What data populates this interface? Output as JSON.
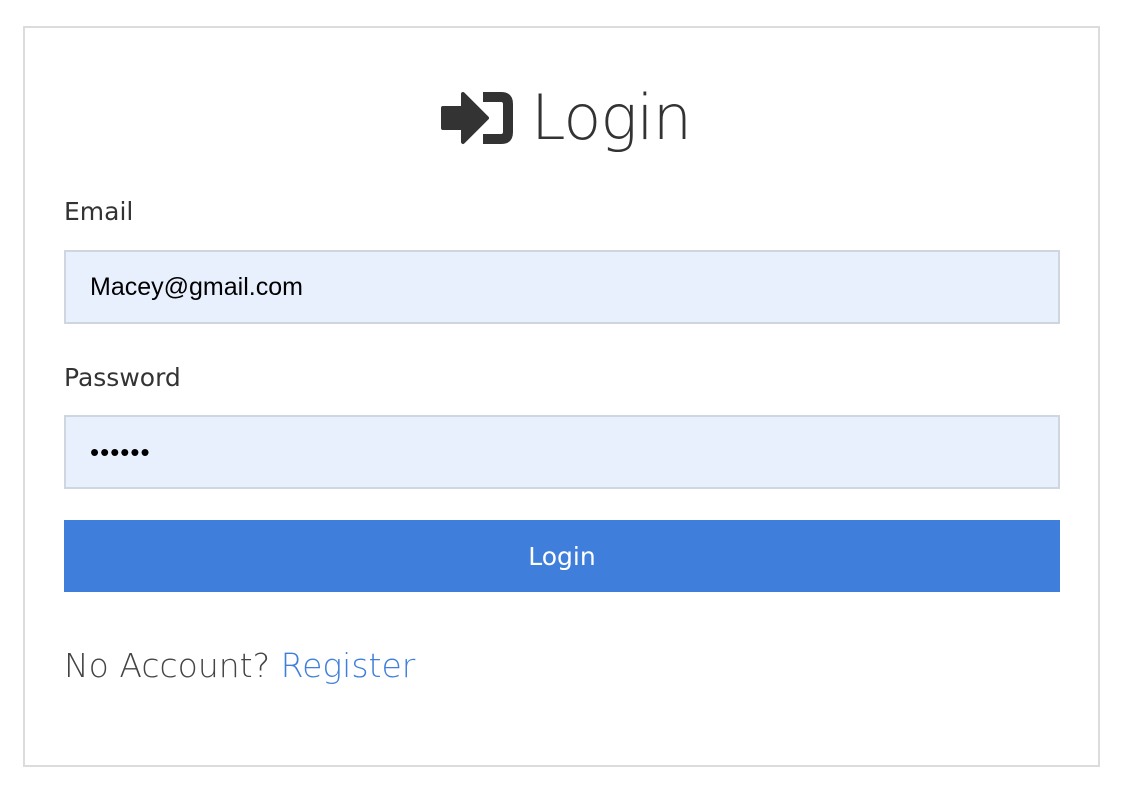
{
  "header": {
    "icon": "sign-in-icon",
    "title": "Login"
  },
  "form": {
    "email_label": "Email",
    "email_value": "Macey@gmail.com",
    "password_label": "Password",
    "password_value": "••••••",
    "submit_label": "Login"
  },
  "footer": {
    "prompt": "No Account?",
    "register_link": "Register"
  },
  "colors": {
    "accent": "#3f7fdb",
    "input_bg": "#e8f0fe",
    "text": "#333333",
    "border": "#dcdcdc"
  }
}
